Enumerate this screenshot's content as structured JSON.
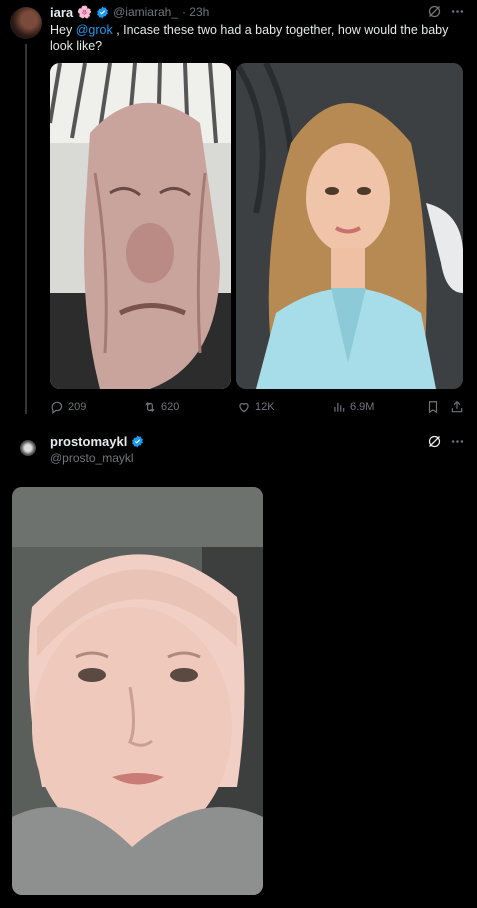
{
  "tweet1": {
    "display_name": "iara",
    "emoji": "🌸",
    "handle": "@iamiarah_",
    "time": "· 23h",
    "text_before": "Hey ",
    "mention": "@grok",
    "text_after": " , Incase these two had a baby together, how would the baby look like?",
    "stats": {
      "replies": "209",
      "reposts": "620",
      "likes": "12K",
      "views": "6.9M"
    }
  },
  "tweet2": {
    "display_name": "prostomaykl",
    "handle": "@prosto_maykl"
  },
  "colors": {
    "accent": "#1d9bf0",
    "muted": "#71767b",
    "text": "#e7e9ea",
    "background": "#000000"
  },
  "icons": [
    "grok-icon",
    "more-icon",
    "verified-badge-icon",
    "reply-icon",
    "repost-icon",
    "like-icon",
    "views-icon",
    "bookmark-icon",
    "share-icon"
  ]
}
